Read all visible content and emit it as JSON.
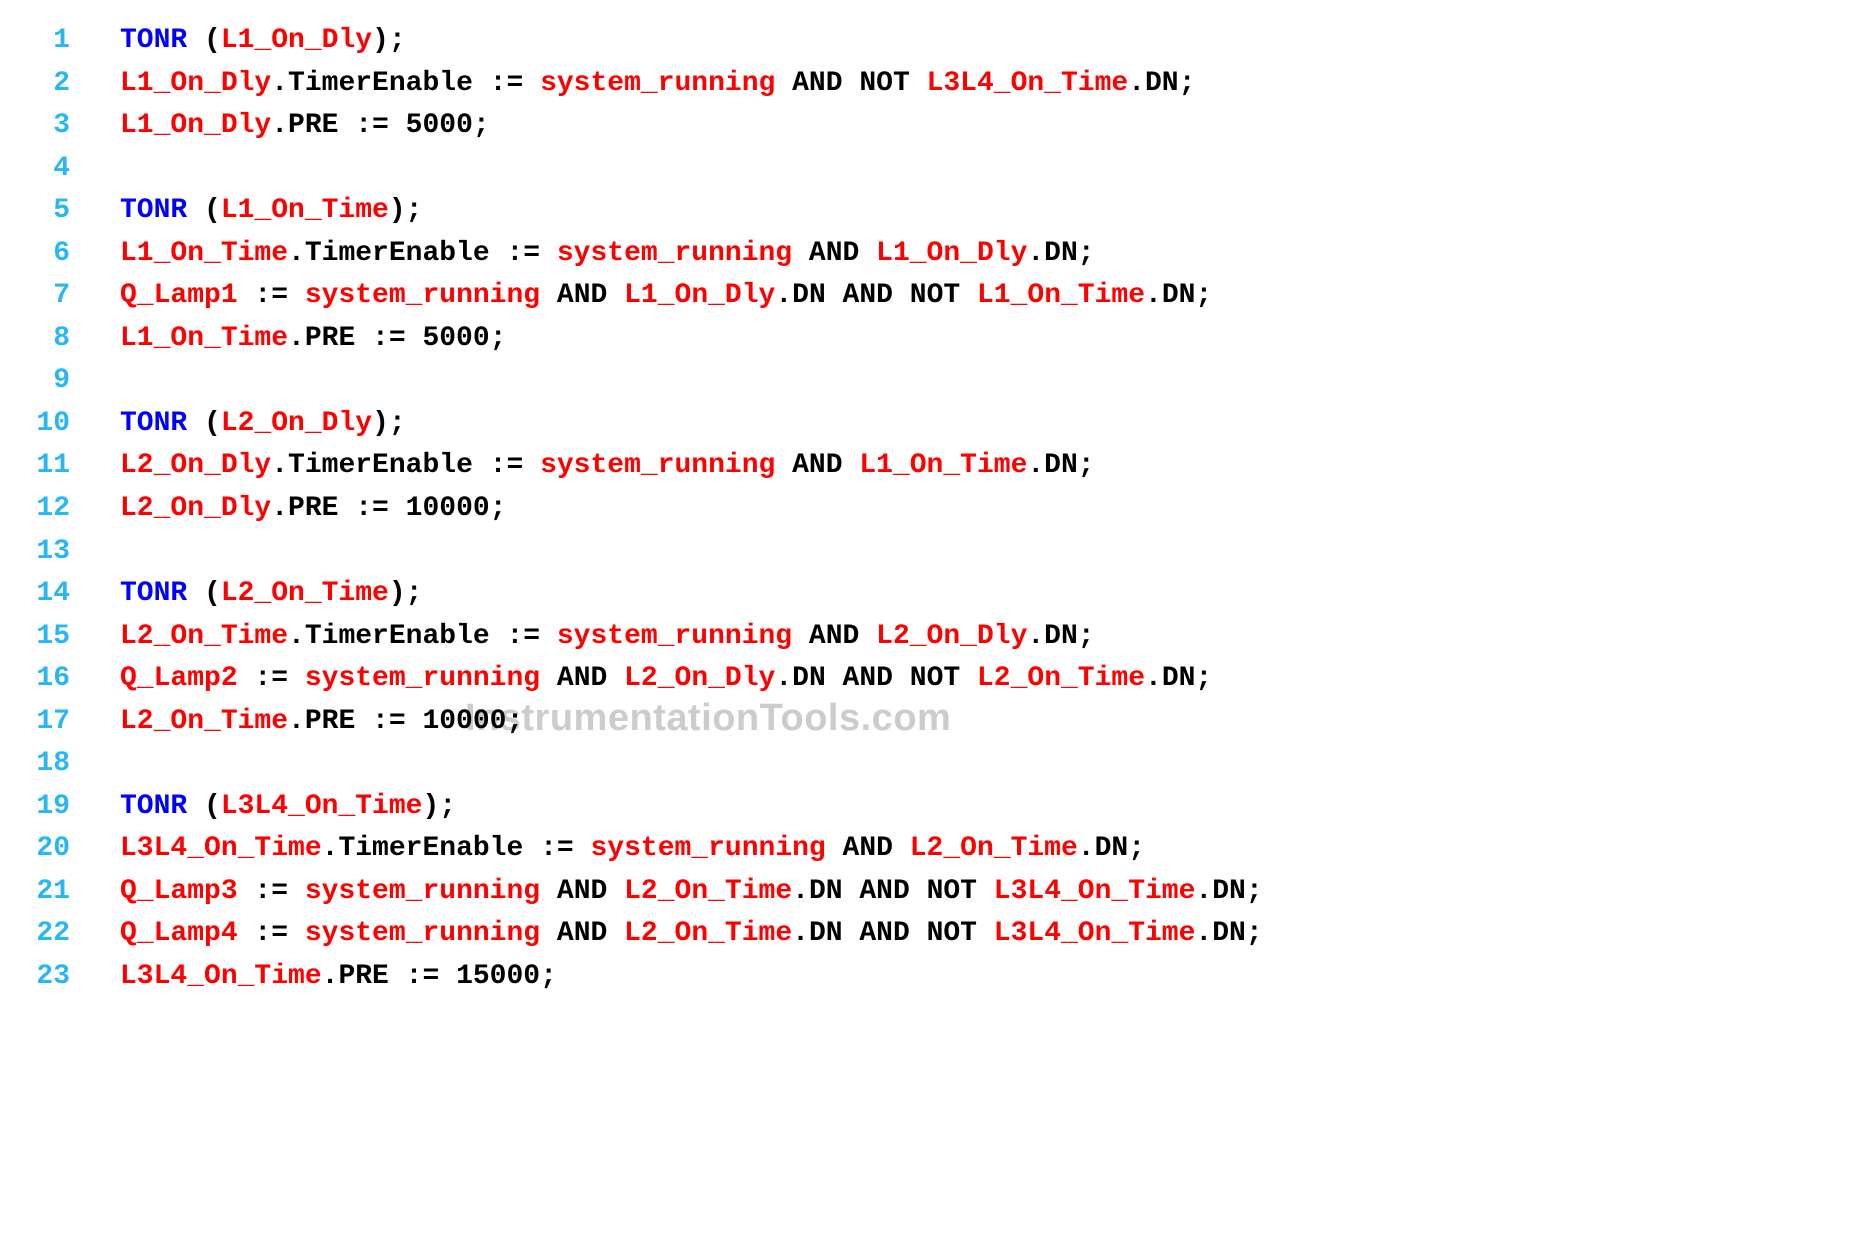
{
  "watermark": "InstrumentationTools.com",
  "lines": [
    {
      "n": "1",
      "tokens": [
        {
          "t": "TONR",
          "c": "kw-func"
        },
        {
          "t": " (",
          "c": "punct"
        },
        {
          "t": "L1_On_Dly",
          "c": "tag"
        },
        {
          "t": ");",
          "c": "punct"
        }
      ]
    },
    {
      "n": "2",
      "tokens": [
        {
          "t": "L1_On_Dly",
          "c": "tag"
        },
        {
          "t": ".TimerEnable := ",
          "c": "member"
        },
        {
          "t": "system_running",
          "c": "tag"
        },
        {
          "t": " AND NOT ",
          "c": "member"
        },
        {
          "t": "L3L4_On_Time",
          "c": "tag"
        },
        {
          "t": ".DN;",
          "c": "member"
        }
      ]
    },
    {
      "n": "3",
      "tokens": [
        {
          "t": "L1_On_Dly",
          "c": "tag"
        },
        {
          "t": ".PRE := 5000;",
          "c": "member"
        }
      ]
    },
    {
      "n": "4",
      "tokens": []
    },
    {
      "n": "5",
      "tokens": [
        {
          "t": "TONR",
          "c": "kw-func"
        },
        {
          "t": " (",
          "c": "punct"
        },
        {
          "t": "L1_On_Time",
          "c": "tag"
        },
        {
          "t": ");",
          "c": "punct"
        }
      ]
    },
    {
      "n": "6",
      "tokens": [
        {
          "t": "L1_On_Time",
          "c": "tag"
        },
        {
          "t": ".TimerEnable := ",
          "c": "member"
        },
        {
          "t": "system_running",
          "c": "tag"
        },
        {
          "t": " AND ",
          "c": "member"
        },
        {
          "t": "L1_On_Dly",
          "c": "tag"
        },
        {
          "t": ".DN;",
          "c": "member"
        }
      ]
    },
    {
      "n": "7",
      "tokens": [
        {
          "t": "Q_Lamp1",
          "c": "tag"
        },
        {
          "t": " := ",
          "c": "member"
        },
        {
          "t": "system_running",
          "c": "tag"
        },
        {
          "t": " AND ",
          "c": "member"
        },
        {
          "t": "L1_On_Dly",
          "c": "tag"
        },
        {
          "t": ".DN AND NOT ",
          "c": "member"
        },
        {
          "t": "L1_On_Time",
          "c": "tag"
        },
        {
          "t": ".DN;",
          "c": "member"
        }
      ]
    },
    {
      "n": "8",
      "tokens": [
        {
          "t": "L1_On_Time",
          "c": "tag"
        },
        {
          "t": ".PRE := 5000;",
          "c": "member"
        }
      ]
    },
    {
      "n": "9",
      "tokens": []
    },
    {
      "n": "10",
      "tokens": [
        {
          "t": "TONR",
          "c": "kw-func"
        },
        {
          "t": " (",
          "c": "punct"
        },
        {
          "t": "L2_On_Dly",
          "c": "tag"
        },
        {
          "t": ");",
          "c": "punct"
        }
      ]
    },
    {
      "n": "11",
      "tokens": [
        {
          "t": "L2_On_Dly",
          "c": "tag"
        },
        {
          "t": ".TimerEnable := ",
          "c": "member"
        },
        {
          "t": "system_running",
          "c": "tag"
        },
        {
          "t": " AND ",
          "c": "member"
        },
        {
          "t": "L1_On_Time",
          "c": "tag"
        },
        {
          "t": ".DN;",
          "c": "member"
        }
      ]
    },
    {
      "n": "12",
      "tokens": [
        {
          "t": "L2_On_Dly",
          "c": "tag"
        },
        {
          "t": ".PRE := 10000;",
          "c": "member"
        }
      ]
    },
    {
      "n": "13",
      "tokens": []
    },
    {
      "n": "14",
      "tokens": [
        {
          "t": "TONR",
          "c": "kw-func"
        },
        {
          "t": " (",
          "c": "punct"
        },
        {
          "t": "L2_On_Time",
          "c": "tag"
        },
        {
          "t": ");",
          "c": "punct"
        }
      ]
    },
    {
      "n": "15",
      "tokens": [
        {
          "t": "L2_On_Time",
          "c": "tag"
        },
        {
          "t": ".TimerEnable := ",
          "c": "member"
        },
        {
          "t": "system_running",
          "c": "tag"
        },
        {
          "t": " AND ",
          "c": "member"
        },
        {
          "t": "L2_On_Dly",
          "c": "tag"
        },
        {
          "t": ".DN;",
          "c": "member"
        }
      ]
    },
    {
      "n": "16",
      "tokens": [
        {
          "t": "Q_Lamp2",
          "c": "tag"
        },
        {
          "t": " := ",
          "c": "member"
        },
        {
          "t": "system_running",
          "c": "tag"
        },
        {
          "t": " AND ",
          "c": "member"
        },
        {
          "t": "L2_On_Dly",
          "c": "tag"
        },
        {
          "t": ".DN AND NOT ",
          "c": "member"
        },
        {
          "t": "L2_On_Time",
          "c": "tag"
        },
        {
          "t": ".DN;",
          "c": "member"
        }
      ]
    },
    {
      "n": "17",
      "tokens": [
        {
          "t": "L2_On_Time",
          "c": "tag"
        },
        {
          "t": ".PRE := 10000;",
          "c": "member"
        }
      ]
    },
    {
      "n": "18",
      "tokens": []
    },
    {
      "n": "19",
      "tokens": [
        {
          "t": "TONR",
          "c": "kw-func"
        },
        {
          "t": " (",
          "c": "punct"
        },
        {
          "t": "L3L4_On_Time",
          "c": "tag"
        },
        {
          "t": ");",
          "c": "punct"
        }
      ]
    },
    {
      "n": "20",
      "tokens": [
        {
          "t": "L3L4_On_Time",
          "c": "tag"
        },
        {
          "t": ".TimerEnable := ",
          "c": "member"
        },
        {
          "t": "system_running",
          "c": "tag"
        },
        {
          "t": " AND ",
          "c": "member"
        },
        {
          "t": "L2_On_Time",
          "c": "tag"
        },
        {
          "t": ".DN;",
          "c": "member"
        }
      ]
    },
    {
      "n": "21",
      "tokens": [
        {
          "t": "Q_Lamp3",
          "c": "tag"
        },
        {
          "t": " := ",
          "c": "member"
        },
        {
          "t": "system_running",
          "c": "tag"
        },
        {
          "t": " AND ",
          "c": "member"
        },
        {
          "t": "L2_On_Time",
          "c": "tag"
        },
        {
          "t": ".DN AND NOT ",
          "c": "member"
        },
        {
          "t": "L3L4_On_Time",
          "c": "tag"
        },
        {
          "t": ".DN;",
          "c": "member"
        }
      ]
    },
    {
      "n": "22",
      "tokens": [
        {
          "t": "Q_Lamp4",
          "c": "tag"
        },
        {
          "t": " := ",
          "c": "member"
        },
        {
          "t": "system_running",
          "c": "tag"
        },
        {
          "t": " AND ",
          "c": "member"
        },
        {
          "t": "L2_On_Time",
          "c": "tag"
        },
        {
          "t": ".DN AND NOT ",
          "c": "member"
        },
        {
          "t": "L3L4_On_Time",
          "c": "tag"
        },
        {
          "t": ".DN;",
          "c": "member"
        }
      ]
    },
    {
      "n": "23",
      "tokens": [
        {
          "t": "L3L4_On_Time",
          "c": "tag"
        },
        {
          "t": ".PRE := 15000;",
          "c": "member"
        }
      ]
    }
  ]
}
